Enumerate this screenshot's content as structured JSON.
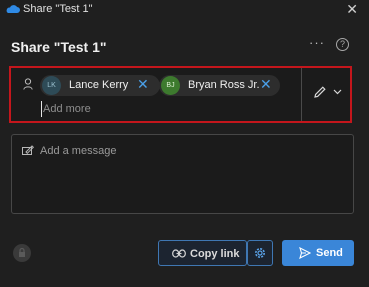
{
  "window": {
    "title": "Share \"Test 1\"",
    "close_symbol": "✕",
    "app_icon": "onedrive-cloud-icon"
  },
  "dialog": {
    "title": "Share \"Test 1\"",
    "more_label": "···",
    "help_label": "?"
  },
  "recipients": {
    "chips": [
      {
        "initials": "LK",
        "name": "Lance Kerry",
        "remove_symbol": "✕"
      },
      {
        "initials": "BJ",
        "name": "Bryan Ross Jr.",
        "remove_symbol": "✕"
      }
    ],
    "add_placeholder": "Add more",
    "permission_icon": "pencil-icon"
  },
  "message": {
    "placeholder": "Add a message"
  },
  "footer": {
    "copy_link_label": "Copy link",
    "send_label": "Send",
    "settings_icon": "gear-icon",
    "privacy_icon": "lock-icon"
  },
  "colors": {
    "accent": "#3a86d8",
    "highlight_border": "#c4161c",
    "background": "#1f1f1f"
  }
}
